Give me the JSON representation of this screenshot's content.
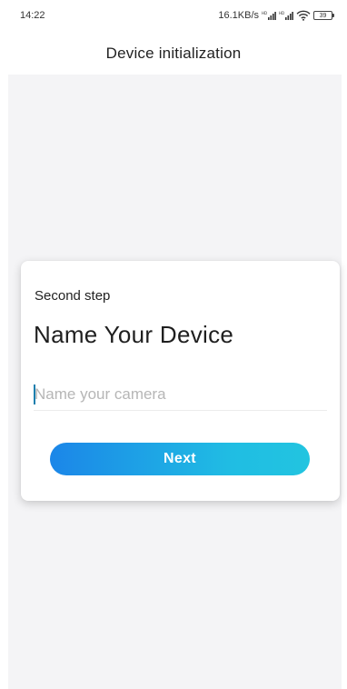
{
  "status_bar": {
    "time": "14:22",
    "network_speed": "16.1KB/s",
    "battery_level": "39",
    "icons": [
      "hd-signal-icon",
      "hd-signal-icon",
      "wifi-icon",
      "battery-icon"
    ]
  },
  "header": {
    "title": "Device initialization"
  },
  "card": {
    "step_label": "Second step",
    "title": "Name Your Device",
    "name_field": {
      "value": "",
      "placeholder": "Name your camera"
    },
    "next_label": "Next"
  },
  "colors": {
    "button_gradient_start": "#1b86e8",
    "button_gradient_end": "#22c4e0",
    "page_background": "#f4f4f6",
    "caret": "#1d7fae"
  }
}
